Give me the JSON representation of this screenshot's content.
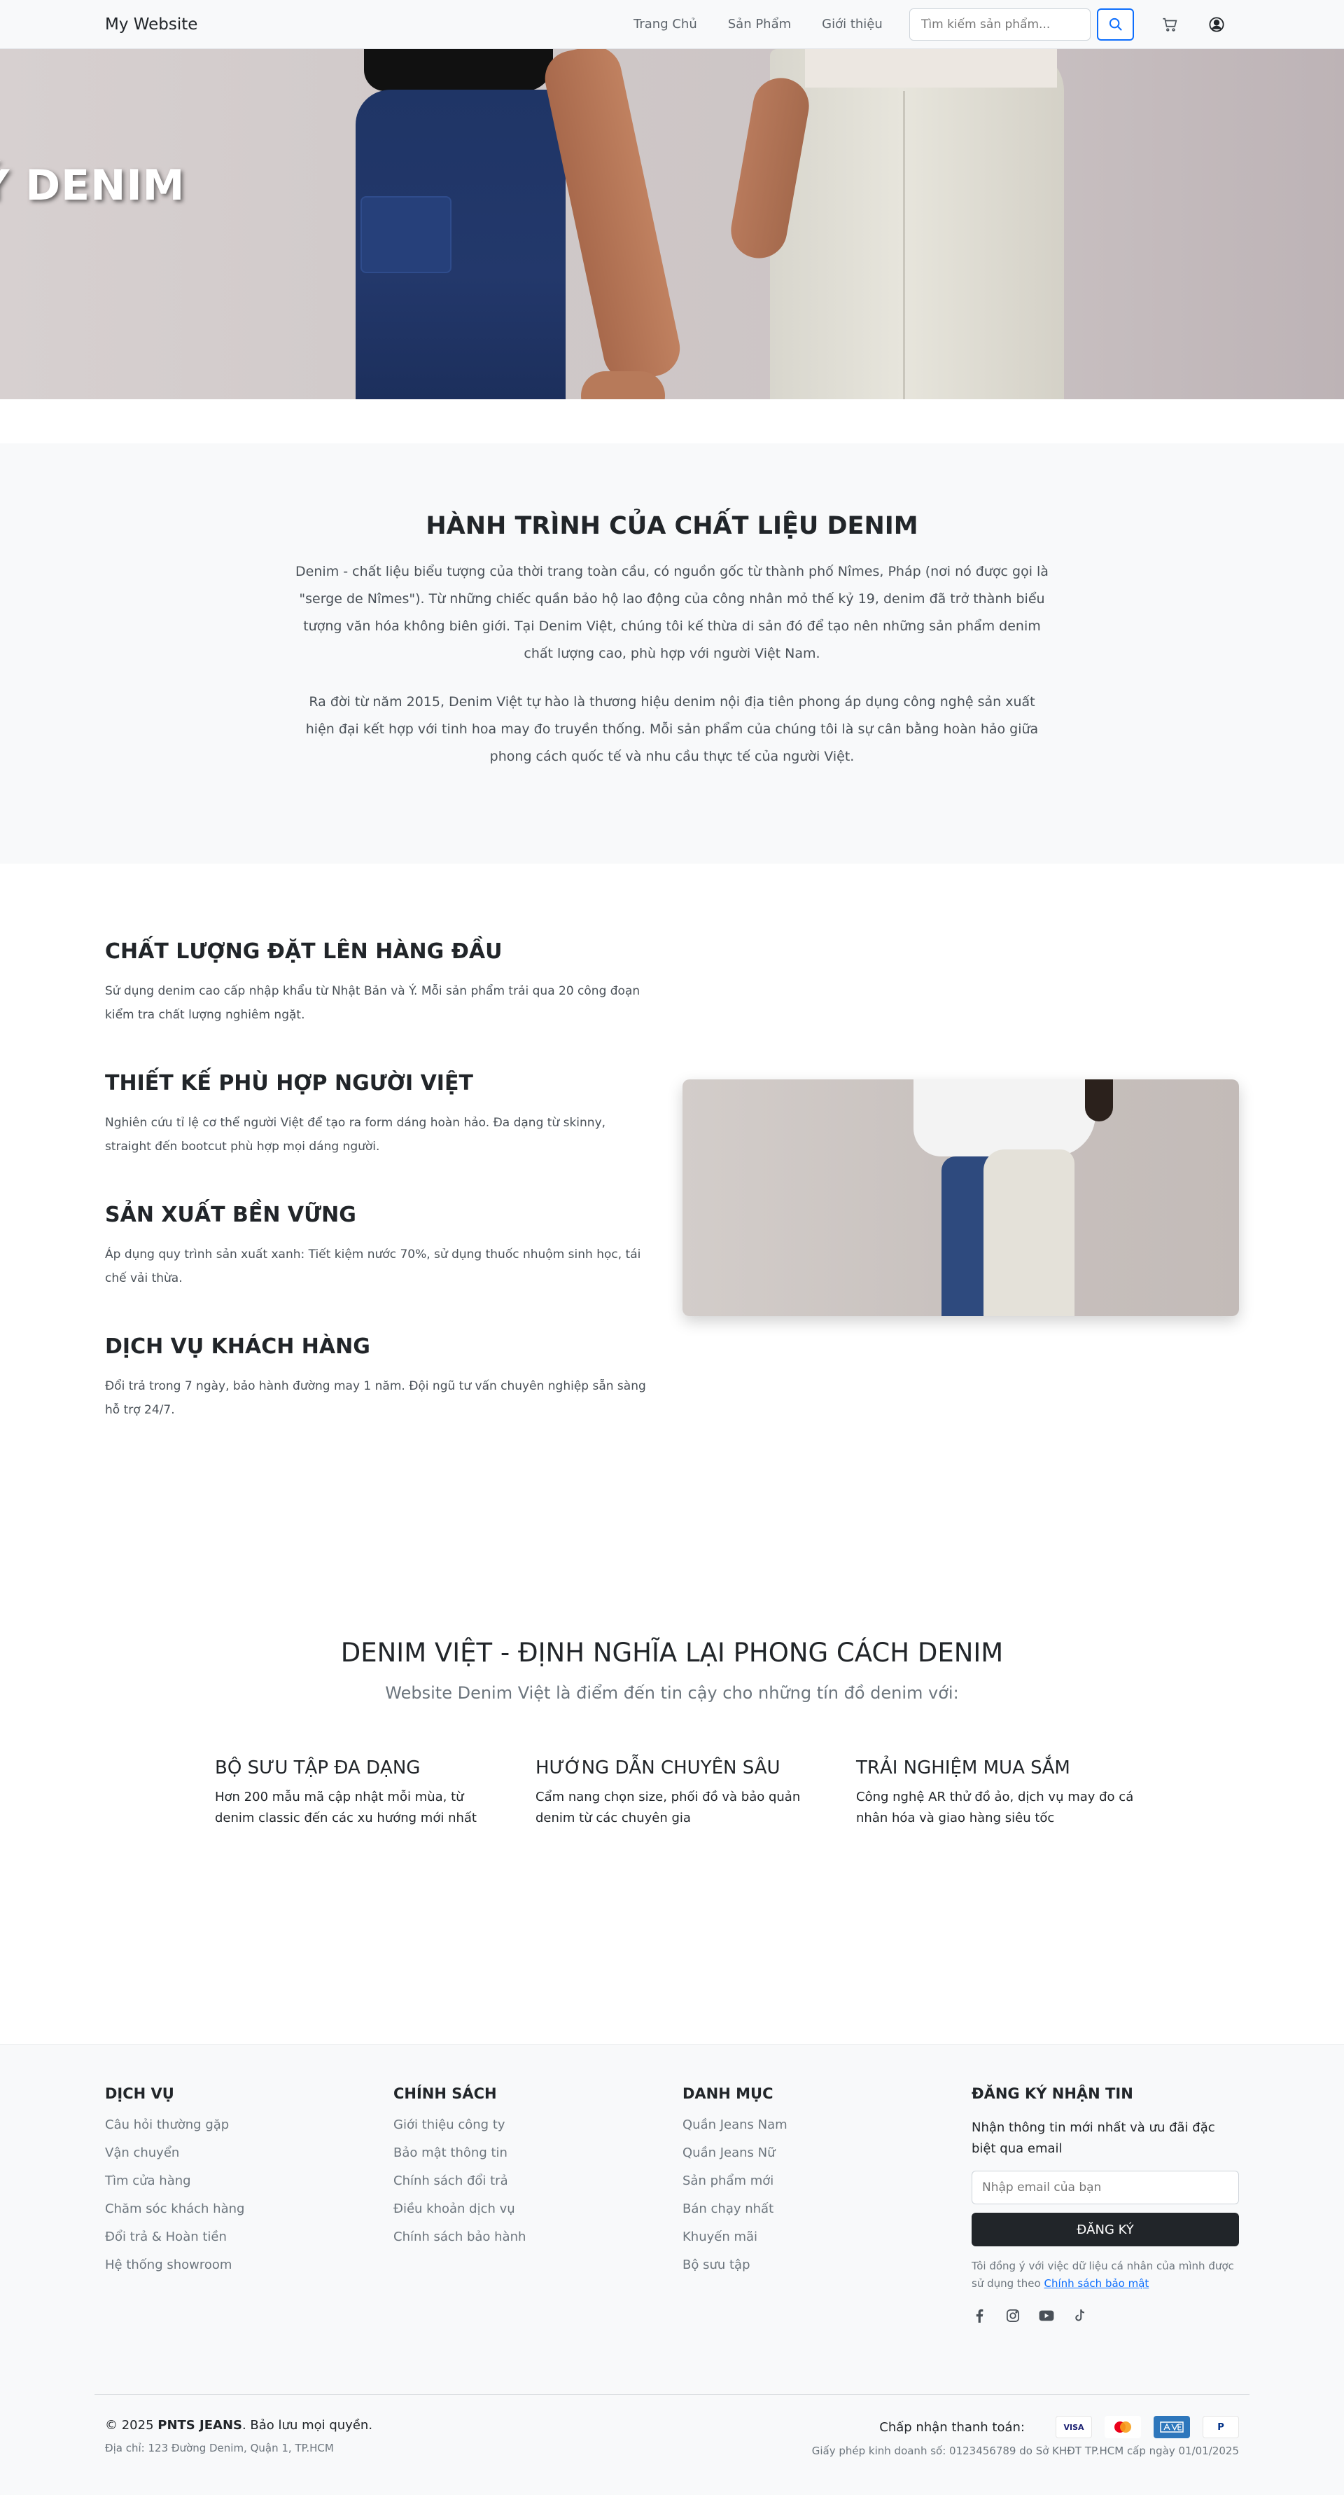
{
  "navbar": {
    "brand": "My Website",
    "links": [
      "Trang Chủ",
      "Sản Phẩm",
      "Giới thiệu"
    ],
    "search_placeholder": "Tìm kiếm sản phẩm..."
  },
  "hero": {
    "title": "Ý DENIM"
  },
  "journey": {
    "title": "HÀNH TRÌNH CỦA CHẤT LIỆU DENIM",
    "paragraph_1": "Denim - chất liệu biểu tượng của thời trang toàn cầu, có nguồn gốc từ thành phố Nîmes, Pháp (nơi nó được gọi là \"serge de Nîmes\"). Từ những chiếc quần bảo hộ lao động của công nhân mỏ thế kỷ 19, denim đã trở thành biểu tượng văn hóa không biên giới. Tại Denim Việt, chúng tôi kế thừa di sản đó để tạo nên những sản phẩm denim chất lượng cao, phù hợp với người Việt Nam.",
    "paragraph_2": "Ra đời từ năm 2015, Denim Việt tự hào là thương hiệu denim nội địa tiên phong áp dụng công nghệ sản xuất hiện đại kết hợp với tinh hoa may đo truyền thống. Mỗi sản phẩm của chúng tôi là sự cân bằng hoàn hảo giữa phong cách quốc tế và nhu cầu thực tế của người Việt."
  },
  "features": [
    {
      "title": "CHẤT LƯỢNG ĐẶT LÊN HÀNG ĐẦU",
      "text": "Sử dụng denim cao cấp nhập khẩu từ Nhật Bản và Ý. Mỗi sản phẩm trải qua 20 công đoạn kiểm tra chất lượng nghiêm ngặt."
    },
    {
      "title": "THIẾT KẾ PHÙ HỢP NGƯỜI VIỆT",
      "text": "Nghiên cứu tỉ lệ cơ thể người Việt để tạo ra form dáng hoàn hảo. Đa dạng từ skinny, straight đến bootcut phù hợp mọi dáng người."
    },
    {
      "title": "SẢN XUẤT BỀN VỮNG",
      "text": "Áp dụng quy trình sản xuất xanh: Tiết kiệm nước 70%, sử dụng thuốc nhuộm sinh học, tái chế vải thừa."
    },
    {
      "title": "DỊCH VỤ KHÁCH HÀNG",
      "text": "Đổi trả trong 7 ngày, bảo hành đường may 1 năm. Đội ngũ tư vấn chuyên nghiệp sẵn sàng hỗ trợ 24/7."
    }
  ],
  "brand": {
    "title": "DENIM VIỆT - ĐỊNH NGHĨA LẠI PHONG CÁCH DENIM",
    "subtitle": "Website Denim Việt là điểm đến tin cậy cho những tín đồ denim với:",
    "columns": [
      {
        "title": "BỘ SƯU TẬP ĐA DẠNG",
        "text": "Hơn 200 mẫu mã cập nhật mỗi mùa, từ denim classic đến các xu hướng mới nhất"
      },
      {
        "title": "HƯỚNG DẪN CHUYÊN SÂU",
        "text": "Cẩm nang chọn size, phối đồ và bảo quản denim từ các chuyên gia"
      },
      {
        "title": "TRẢI NGHIỆM MUA SẮM",
        "text": "Công nghệ AR thử đồ ảo, dịch vụ may đo cá nhân hóa và giao hàng siêu tốc"
      }
    ]
  },
  "footer": {
    "services": {
      "title": "DỊCH VỤ",
      "links": [
        "Câu hỏi thường gặp",
        "Vận chuyển",
        "Tìm cửa hàng",
        "Chăm sóc khách hàng",
        "Đổi trả & Hoàn tiền",
        "Hệ thống showroom"
      ]
    },
    "policies": {
      "title": "CHÍNH SÁCH",
      "links": [
        "Giới thiệu công ty",
        "Bảo mật thông tin",
        "Chính sách đổi trả",
        "Điều khoản dịch vụ",
        "Chính sách bảo hành"
      ]
    },
    "categories": {
      "title": "DANH MỤC",
      "links": [
        "Quần Jeans Nam",
        "Quần Jeans Nữ",
        "Sản phẩm mới",
        "Bán chạy nhất",
        "Khuyến mãi",
        "Bộ sưu tập"
      ]
    },
    "newsletter": {
      "title": "ĐĂNG KÝ NHẬN TIN",
      "lead": "Nhận thông tin mới nhất và ưu đãi đặc biệt qua email",
      "email_placeholder": "Nhập email của bạn",
      "button": "ĐĂNG KÝ",
      "consent_text": "Tôi đồng ý với việc dữ liệu cá nhân của mình được sử dụng theo ",
      "consent_link": "Chính sách bảo mật"
    },
    "social_icons": [
      "facebook-icon",
      "instagram-icon",
      "youtube-icon",
      "tiktok-icon"
    ],
    "copyright_prefix": "© 2025 ",
    "copyright_brand": "PNTS JEANS",
    "copyright_suffix": ". Bảo lưu mọi quyền.",
    "address": "Địa chỉ: 123 Đường Denim, Quận 1, TP.HCM",
    "payment_label": "Chấp nhận thanh toán:",
    "payment_cards": [
      "VISA",
      "MASTERCARD",
      "AMEX",
      "PAYPAL"
    ],
    "license": "Giấy phép kinh doanh số: 0123456789 do Sở KHĐT TP.HCM cấp ngày 01/01/2025"
  }
}
